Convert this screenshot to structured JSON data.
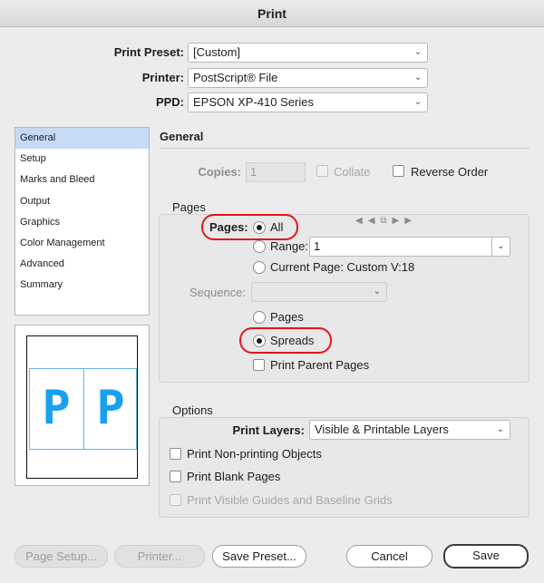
{
  "window": {
    "title": "Print"
  },
  "top": {
    "preset_label": "Print Preset:",
    "preset_value": "[Custom]",
    "printer_label": "Printer:",
    "printer_value": "PostScript® File",
    "ppd_label": "PPD:",
    "ppd_value": "EPSON XP-410 Series"
  },
  "sidebar": {
    "items": [
      {
        "label": "General",
        "selected": true
      },
      {
        "label": "Setup"
      },
      {
        "label": "Marks and Bleed"
      },
      {
        "label": "Output"
      },
      {
        "label": "Graphics"
      },
      {
        "label": "Color Management"
      },
      {
        "label": "Advanced"
      },
      {
        "label": "Summary"
      }
    ]
  },
  "preview": {
    "left_glyph": "P",
    "right_glyph": "P"
  },
  "general": {
    "title": "General",
    "copies_label": "Copies:",
    "copies_value": "1",
    "collate_label": "Collate",
    "reverse_label": "Reverse Order"
  },
  "pages": {
    "title": "Pages",
    "pages_label": "Pages:",
    "all_label": "All",
    "range_label": "Range:",
    "range_value": "1",
    "current_label": "Current Page: Custom V:18",
    "sequence_label": "Sequence:",
    "sequence_value": "",
    "pages_option": "Pages",
    "spreads_option": "Spreads",
    "parent_label": "Print Parent Pages",
    "nav_icons": [
      "first-page-icon",
      "prev-page-icon",
      "page-copy-icon",
      "next-page-icon",
      "last-page-icon"
    ]
  },
  "options": {
    "title": "Options",
    "layers_label": "Print Layers:",
    "layers_value": "Visible & Printable Layers",
    "nonprinting_label": "Print Non-printing Objects",
    "blank_label": "Print Blank Pages",
    "guides_label": "Print Visible Guides and Baseline Grids"
  },
  "buttons": {
    "page_setup": "Page Setup...",
    "printer": "Printer...",
    "save_preset": "Save Preset...",
    "cancel": "Cancel",
    "save": "Save"
  },
  "colors": {
    "highlight": "#e4141c",
    "selection": "#c6daf3",
    "preview_glyph": "#1aa0ef"
  }
}
